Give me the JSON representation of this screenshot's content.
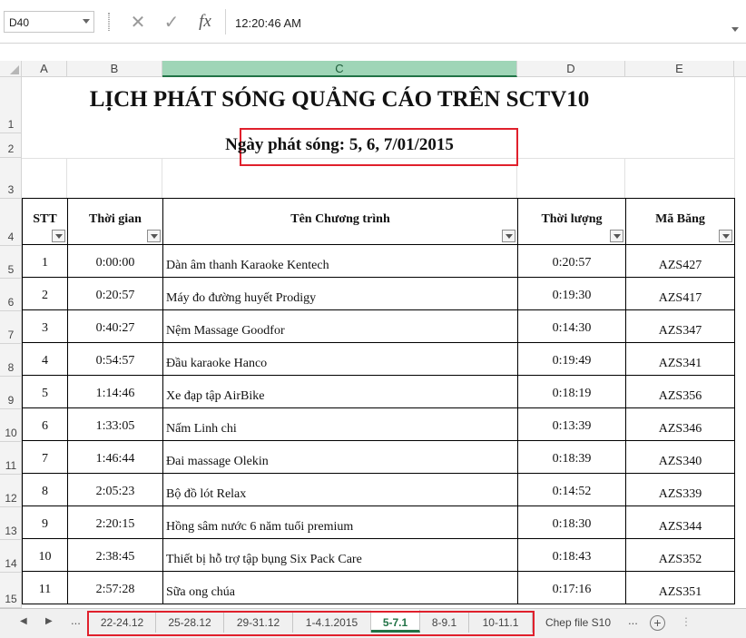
{
  "formula_bar": {
    "name_box": "D40",
    "cancel_icon": "✕",
    "enter_icon": "✓",
    "fx_label": "fx",
    "formula_value": "12:20:46 AM"
  },
  "columns": [
    "A",
    "B",
    "C",
    "D",
    "E"
  ],
  "rows": [
    "1",
    "2",
    "3",
    "4",
    "5",
    "6",
    "7",
    "8",
    "9",
    "10",
    "11",
    "12",
    "13",
    "14",
    "15"
  ],
  "sheet": {
    "title": "LỊCH PHÁT SÓNG QUẢNG CÁO TRÊN SCTV10",
    "subtitle": "Ngày phát sóng: 5, 6, 7/01/2015",
    "headers": [
      "STT",
      "Thời gian",
      "Tên Chương trình",
      "Thời lượng",
      "Mã Băng"
    ],
    "rows": [
      [
        "1",
        "0:00:00",
        "Dàn âm thanh Karaoke Kentech",
        "0:20:57",
        "AZS427"
      ],
      [
        "2",
        "0:20:57",
        "Máy đo đường huyết Prodigy",
        "0:19:30",
        "AZS417"
      ],
      [
        "3",
        "0:40:27",
        "Nệm Massage Goodfor",
        "0:14:30",
        "AZS347"
      ],
      [
        "4",
        "0:54:57",
        "Đầu karaoke Hanco",
        "0:19:49",
        "AZS341"
      ],
      [
        "5",
        "1:14:46",
        "Xe đạp tập AirBike",
        "0:18:19",
        "AZS356"
      ],
      [
        "6",
        "1:33:05",
        "Nấm Linh chi",
        "0:13:39",
        "AZS346"
      ],
      [
        "7",
        "1:46:44",
        "Đai massage Olekin",
        "0:18:39",
        "AZS340"
      ],
      [
        "8",
        "2:05:23",
        "Bộ đồ lót Relax",
        "0:14:52",
        "AZS339"
      ],
      [
        "9",
        "2:20:15",
        "Hồng sâm nước 6 năm tuổi premium",
        "0:18:30",
        "AZS344"
      ],
      [
        "10",
        "2:38:45",
        "Thiết bị hỗ trợ tập bụng Six Pack Care",
        "0:18:43",
        "AZS352"
      ],
      [
        "11",
        "2:57:28",
        "Sữa ong chúa",
        "0:17:16",
        "AZS351"
      ]
    ]
  },
  "tabs": {
    "nav_prev": "◀",
    "nav_next": "▶",
    "more_left": "...",
    "items": [
      "22-24.12",
      "25-28.12",
      "29-31.12",
      "1-4.1.2015",
      "5-7.1",
      "8-9.1",
      "10-11.1",
      "Chep file S10"
    ],
    "active": "5-7.1",
    "more_right": "...",
    "add_label": "+",
    "menu_dots": "⋮"
  },
  "colors": {
    "accent_green": "#217346",
    "highlight_red": "#e0202c",
    "selected_column_fill": "#9fd5b7"
  }
}
